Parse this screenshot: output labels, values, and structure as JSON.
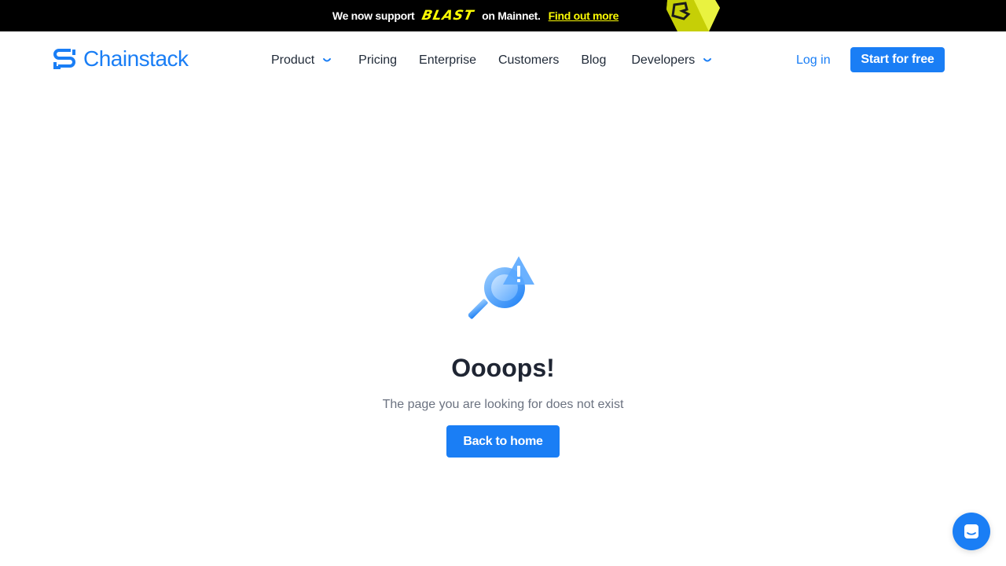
{
  "announcement": {
    "prefix": "We now support",
    "brand": "BLAST",
    "suffix": "on Mainnet.",
    "link": "Find out more"
  },
  "header": {
    "logo_text": "Chainstack",
    "nav": [
      {
        "label": "Product",
        "has_dropdown": true
      },
      {
        "label": "Pricing",
        "has_dropdown": false
      },
      {
        "label": "Enterprise",
        "has_dropdown": false
      },
      {
        "label": "Customers",
        "has_dropdown": false
      },
      {
        "label": "Blog",
        "has_dropdown": false
      },
      {
        "label": "Developers",
        "has_dropdown": true
      }
    ],
    "login_label": "Log in",
    "cta_label": "Start for free"
  },
  "error": {
    "title": "Oooops!",
    "message": "The page you are looking for does not exist",
    "button_label": "Back to home",
    "icon": "search-warning-icon"
  },
  "chat": {
    "icon": "chat-icon"
  },
  "colors": {
    "accent": "#1a7ef5",
    "announcement_bg": "#000000",
    "announcement_highlight": "#fcfc03",
    "text_dark": "#1f2533",
    "text_muted": "#6b7280"
  }
}
